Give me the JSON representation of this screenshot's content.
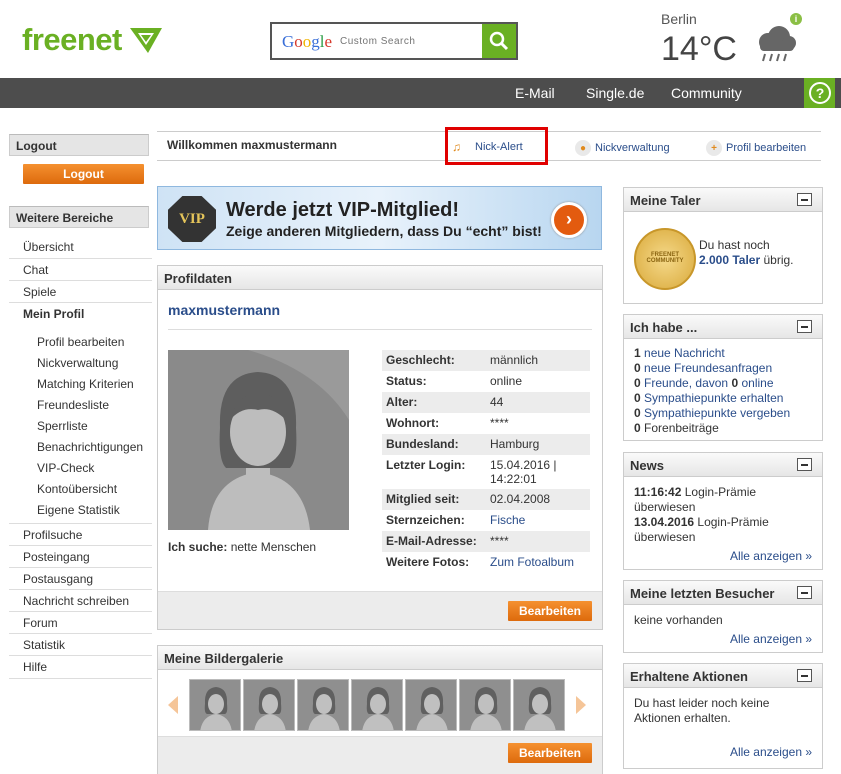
{
  "header": {
    "logo_text": "freenet",
    "search": {
      "brand": "Google",
      "placeholder": "Custom Search"
    },
    "weather": {
      "city": "Berlin",
      "temperature": "14°C",
      "icon": "rain-cloud-icon"
    },
    "info_label": "i"
  },
  "nav": {
    "items": [
      "E-Mail",
      "Single.de",
      "Community"
    ],
    "help_icon": "help-icon"
  },
  "sidebar": {
    "logout_title": "Logout",
    "logout_button": "Logout",
    "areas_title": "Weitere Bereiche",
    "items": [
      {
        "label": "Übersicht",
        "active": false
      },
      {
        "label": "Chat",
        "active": false
      },
      {
        "label": "Spiele",
        "active": false
      },
      {
        "label": "Mein Profil",
        "active": true
      }
    ],
    "subitems": [
      "Profil bearbeiten",
      "Nickverwaltung",
      "Matching Kriterien",
      "Freundesliste",
      "Sperrliste",
      "Benachrichtigungen",
      "VIP-Check",
      "Kontoübersicht",
      "Eigene Statistik"
    ],
    "items_after": [
      "Profilsuche",
      "Posteingang",
      "Postausgang",
      "Nachricht schreiben",
      "Forum",
      "Statistik",
      "Hilfe"
    ]
  },
  "welcome": {
    "text": "Willkommen maxmustermann",
    "links": [
      "Nick-Alert",
      "Nickverwaltung",
      "Profil bearbeiten"
    ]
  },
  "banner": {
    "badge": "VIP",
    "headline": "Werde jetzt VIP-Mitglied!",
    "subline": "Zeige anderen Mitgliedern, dass Du “echt” bist!"
  },
  "profile": {
    "title": "Profildaten",
    "username": "maxmustermann",
    "search_label": "Ich suche:",
    "search_value": "nette Menschen",
    "fields": [
      {
        "key": "Geschlecht:",
        "value": "männlich",
        "link": false
      },
      {
        "key": "Status:",
        "value": "online",
        "link": false
      },
      {
        "key": "Alter:",
        "value": "44",
        "link": false
      },
      {
        "key": "Wohnort:",
        "value": "****",
        "link": false
      },
      {
        "key": "Bundesland:",
        "value": "Hamburg",
        "link": false
      },
      {
        "key": "Letzter Login:",
        "value": "15.04.2016 | 14:22:01",
        "link": false
      },
      {
        "key": "Mitglied seit:",
        "value": "02.04.2008",
        "link": false
      },
      {
        "key": "Sternzeichen:",
        "value": "Fische",
        "link": true
      },
      {
        "key": "E-Mail-Adresse:",
        "value": "****",
        "link": false
      },
      {
        "key": "Weitere Fotos:",
        "value": "Zum Fotoalbum",
        "link": true
      }
    ],
    "edit_button": "Bearbeiten"
  },
  "gallery": {
    "title": "Meine Bildergalerie",
    "thumb_count": 7,
    "edit_button": "Bearbeiten"
  },
  "right": {
    "taler": {
      "title": "Meine Taler",
      "coin_text": "FREENET COMMUNITY",
      "text_pre": "Du hast noch",
      "amount": "2.000 Taler",
      "text_post": "übrig."
    },
    "ichhabe": {
      "title": "Ich habe ...",
      "lines": [
        {
          "count": "1",
          "label": "neue Nachricht"
        },
        {
          "count": "0",
          "label": "neue Freundesanfragen"
        },
        {
          "count": "0",
          "label": "Freunde, davon",
          "count2": "0",
          "label2": "online"
        },
        {
          "count": "0",
          "label": "Sympathiepunkte erhalten"
        },
        {
          "count": "0",
          "label": "Sympathiepunkte vergeben"
        },
        {
          "count": "0",
          "label": "Forenbeiträge"
        }
      ]
    },
    "news": {
      "title": "News",
      "items": [
        {
          "time": "11:16:42",
          "text": "Login-Prämie überwiesen"
        },
        {
          "time": "13.04.2016",
          "text": "Login-Prämie überwiesen"
        }
      ],
      "more": "Alle anzeigen »"
    },
    "visitors": {
      "title": "Meine letzten Besucher",
      "text": "keine vorhanden",
      "more": "Alle anzeigen »"
    },
    "actions": {
      "title": "Erhaltene Aktionen",
      "text": "Du hast leider noch keine Aktionen erhalten.",
      "more": "Alle anzeigen »"
    }
  }
}
